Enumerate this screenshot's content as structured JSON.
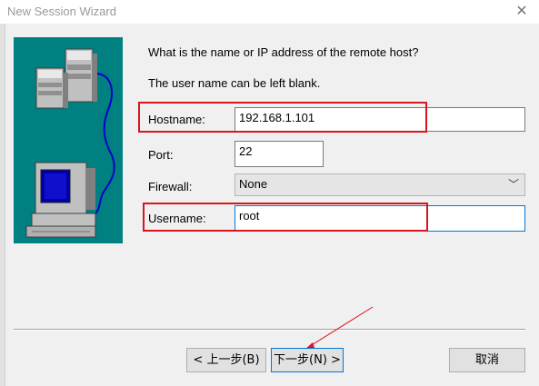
{
  "window": {
    "title": "New Session Wizard",
    "close_glyph": "✕"
  },
  "prompt": {
    "question": "What is the name or IP address of the remote host?",
    "note": "The user name can be left blank."
  },
  "fields": {
    "hostname": {
      "label": "Hostname:",
      "value": "192.168.1.101"
    },
    "port": {
      "label": "Port:",
      "value": "22"
    },
    "firewall": {
      "label": "Firewall:",
      "selected": "None"
    },
    "username": {
      "label": "Username:",
      "value": "root"
    }
  },
  "buttons": {
    "back": "< 上一步(B)",
    "next": "下一步(N) >",
    "cancel": "取消"
  },
  "colors": {
    "illustration_bg": "#008080",
    "highlight": "#d9161f",
    "default_button_border": "#0078d7"
  },
  "icons": [
    "servers-icon",
    "computer-icon",
    "network-cable-icon",
    "chevron-down-icon",
    "close-icon",
    "arrow-annotation"
  ]
}
